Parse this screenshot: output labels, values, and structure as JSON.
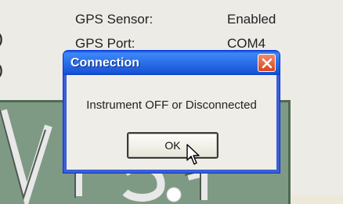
{
  "background": {
    "gps_sensor_label": "GPS Sensor:",
    "gps_sensor_value": "Enabled",
    "gps_port_label": "GPS Port:",
    "gps_port_value": "COM4",
    "side_marks": [
      ")",
      ")"
    ]
  },
  "dialog": {
    "title": "Connection",
    "message": "Instrument OFF or Disconnected",
    "ok_label": "OK",
    "close_icon": "close-icon",
    "title_color": "#2a6ee8",
    "close_color": "#d8451e"
  }
}
